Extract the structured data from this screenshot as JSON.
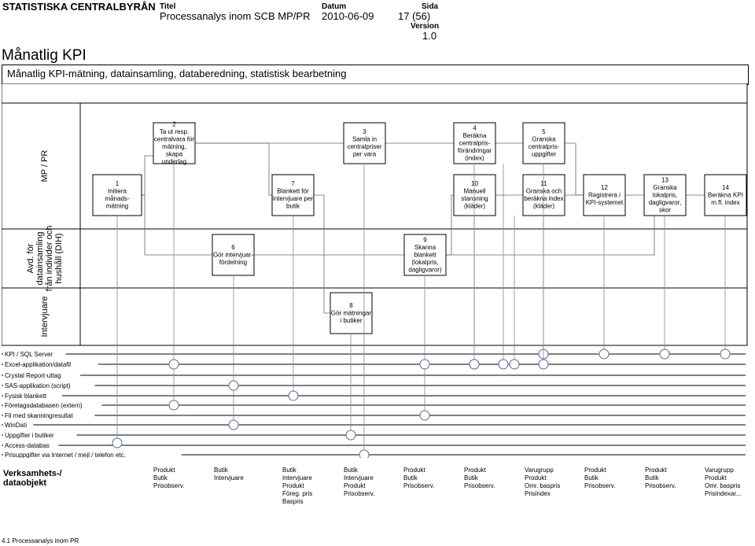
{
  "header": {
    "org": "STATISTISKA CENTRALBYRÅN",
    "title_label": "Titel",
    "title": "Processanalys inom SCB MP/PR",
    "date_label": "Datum",
    "date": "2010-06-09",
    "page_label": "Sida",
    "page": "17 (56)",
    "version_label": "Version",
    "version": "1.0"
  },
  "page_title": "Månatlig KPI",
  "subtitle": "Månatlig KPI-mätning, datainsamling, databeredning, statistisk bearbetning",
  "lanes": [
    {
      "label": "MP / PR"
    },
    {
      "label_lines": [
        "Avd. för",
        "datainsamling",
        "från individer och",
        "hushåll (DIH)"
      ]
    },
    {
      "label": "Intervjuare"
    }
  ],
  "processes": [
    {
      "id": "1",
      "lines": [
        "Initiera",
        "månads-",
        "mätning"
      ]
    },
    {
      "id": "2",
      "lines": [
        "Ta ut resp.",
        "centralvara för",
        "mätning,",
        "skapa",
        "underlag"
      ]
    },
    {
      "id": "3",
      "lines": [
        "Samla in",
        "centralpriser",
        "per vara"
      ]
    },
    {
      "id": "4",
      "lines": [
        "Beräkna",
        "centralpris-",
        "förändringar",
        "(index)"
      ]
    },
    {
      "id": "5",
      "lines": [
        "Granska",
        "centralpris-",
        "uppgifter"
      ]
    },
    {
      "id": "6",
      "lines": [
        "Gör intervjuar-",
        "fördelning"
      ]
    },
    {
      "id": "7",
      "lines": [
        "Blankett för",
        "intervjuare per",
        "butik"
      ]
    },
    {
      "id": "8",
      "lines": [
        "Gör mätningar",
        "i butiker"
      ]
    },
    {
      "id": "9",
      "lines": [
        "Skanna",
        "blankett",
        "(lokalpris,",
        "dagligvaror)"
      ]
    },
    {
      "id": "10",
      "lines": [
        "Manuell",
        "stansning",
        "(kläder)"
      ]
    },
    {
      "id": "11",
      "lines": [
        "Granska och",
        "beräkna index",
        "(kläder)"
      ]
    },
    {
      "id": "12",
      "lines": [
        "Registrera i",
        "KPI-systemet"
      ]
    },
    {
      "id": "13",
      "lines": [
        "Granska",
        "lokalpris,",
        "dagligvaror,",
        "skor"
      ]
    },
    {
      "id": "14",
      "lines": [
        "Beräkna KPI",
        "m.fl. index"
      ]
    }
  ],
  "systems": [
    "KPI / SQL Server",
    "Excel-applikation/datafil",
    "Crystal Report-uttag",
    "SAS-applikation (script)",
    "Fysisk blankett",
    "Företagsdatabasen (extern)",
    "Fil med skanningresultat",
    "WinDati",
    "Uppgifter i butiker",
    "Access-databas",
    "Prisuppgifter via Internet / mejl / telefon etc."
  ],
  "dataobjects_title": [
    "Verksamhets-/",
    "dataobjekt"
  ],
  "dataobjects": [
    [
      "Produkt",
      "Butik",
      "Prisobserv."
    ],
    [
      "Butik",
      "Intervjuare"
    ],
    [
      "Butik",
      "Intervjuare",
      "Produkt",
      "Föreg. pris",
      "Baspris"
    ],
    [
      "Butik",
      "Intervjuare",
      "Produkt",
      "Prisobserv."
    ],
    [
      "Produkt",
      "Butik",
      "Prisobserv."
    ],
    [
      "Produkt",
      "Butik",
      "Prisobserv."
    ],
    [
      "Varugrupp",
      "Produkt",
      "Omr. baspris",
      "Prisindex"
    ],
    [
      "Produkt",
      "Butik",
      "Prisobserv."
    ],
    [
      "Produkt",
      "Butik",
      "Prisobserv."
    ],
    [
      "Varugrupp",
      "Produkt",
      "Omr. baspris",
      "Prisindexar..."
    ]
  ],
  "footer": "4.1 Processanalys inom PR"
}
